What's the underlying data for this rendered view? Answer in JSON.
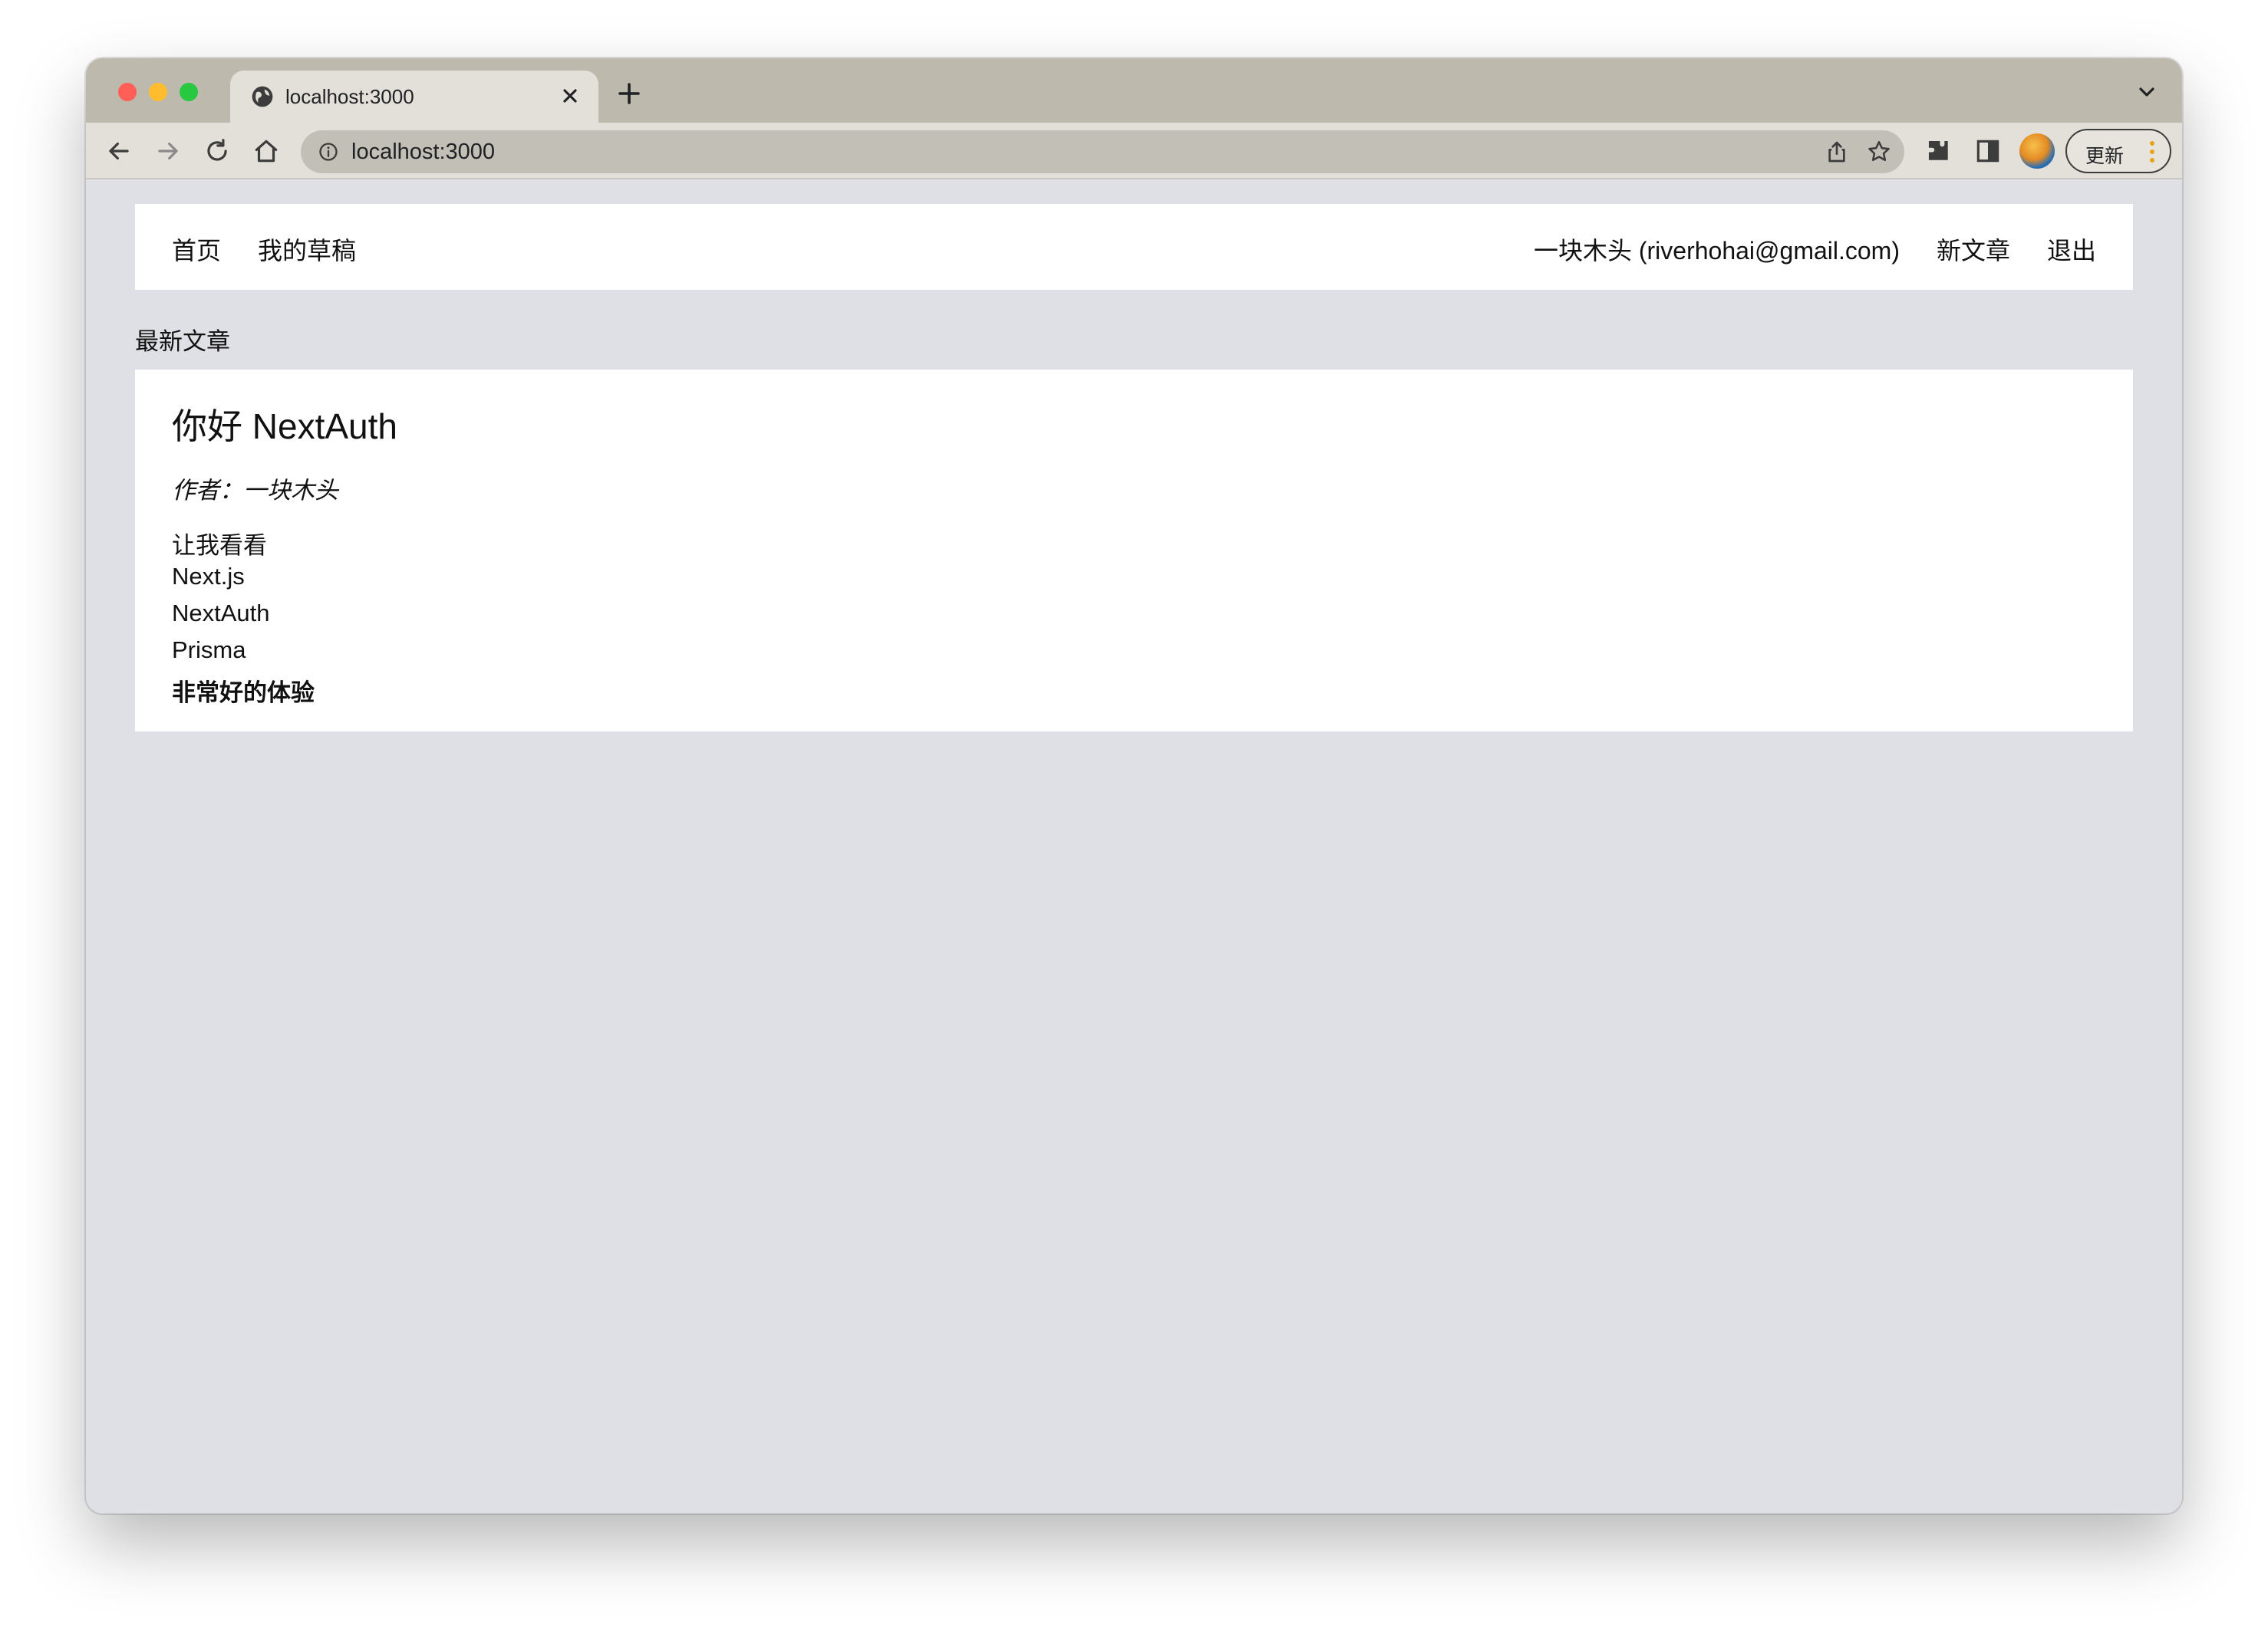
{
  "browser": {
    "tab": {
      "title": "localhost:3000"
    },
    "address_bar": {
      "url": "localhost:3000"
    },
    "update_button": {
      "label": "更新"
    }
  },
  "site_nav": {
    "left_links": [
      "首页",
      "我的草稿"
    ],
    "user": "一块木头 (riverhohai@gmail.com)",
    "new_post": "新文章",
    "logout": "退出"
  },
  "feed": {
    "heading": "最新文章",
    "posts": [
      {
        "title": "你好 NextAuth",
        "author": "作者：一块木头",
        "content_lines": [
          "让我看看",
          "Next.js",
          "NextAuth",
          "Prisma"
        ],
        "content_bold_line": "非常好的体验"
      }
    ]
  },
  "colors": {
    "tabstrip": "#bdbaad",
    "toolbar": "#e2e0d8",
    "page_background": "#dfe0e5",
    "card_background": "#ffffff"
  }
}
